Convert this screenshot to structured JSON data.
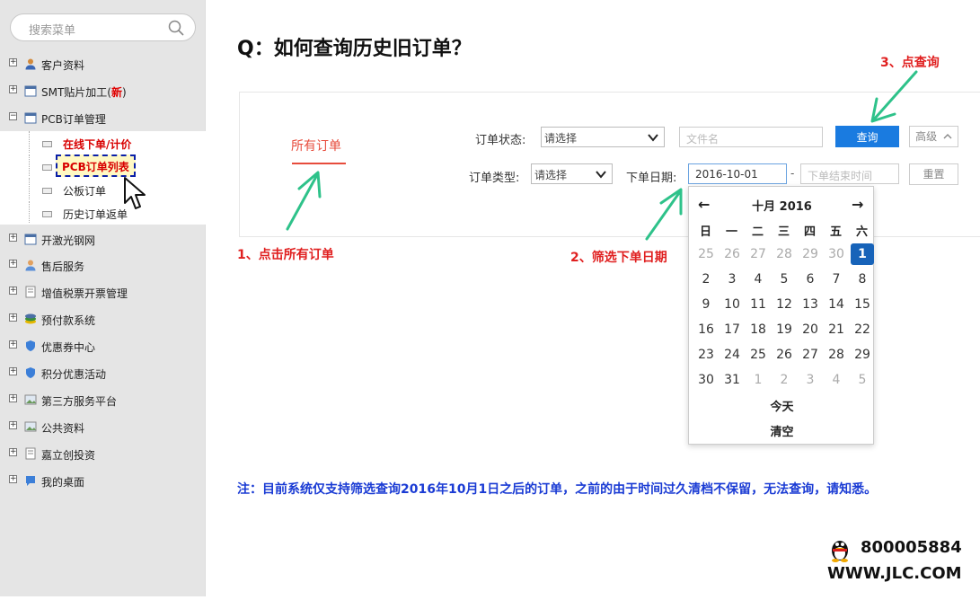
{
  "sidebar": {
    "search_placeholder": "搜索菜单",
    "items": [
      {
        "label": "客户资料"
      },
      {
        "label": "SMT贴片加工(",
        "badge": "新",
        "suffix": ")"
      },
      {
        "label": "PCB订单管理"
      },
      {
        "label": "开激光钢网"
      },
      {
        "label": "售后服务"
      },
      {
        "label": "增值税票开票管理"
      },
      {
        "label": "预付款系统"
      },
      {
        "label": "优惠券中心"
      },
      {
        "label": "积分优惠活动"
      },
      {
        "label": "第三方服务平台"
      },
      {
        "label": "公共资料"
      },
      {
        "label": "嘉立创投资"
      },
      {
        "label": "我的桌面"
      }
    ],
    "submenu": [
      "在线下单/计价",
      "PCB订单列表",
      "公板订单",
      "历史订单返单"
    ]
  },
  "heading": "Q：如何查询历史旧订单？",
  "tab_all": "所有订单",
  "filters": {
    "status_label": "订单状态:",
    "status_value": "请选择",
    "file_placeholder": "文件名",
    "query_button": "查询",
    "advanced_button": "高级",
    "type_label": "订单类型:",
    "type_value": "请选择",
    "date_label": "下单日期:",
    "date_start": "2016-10-01",
    "date_separator": "-",
    "date_end_placeholder": "下单结束时间",
    "reset_button": "重置"
  },
  "calendar": {
    "title": "十月 2016",
    "prev": "←",
    "next": "→",
    "weekdays": [
      "日",
      "一",
      "二",
      "三",
      "四",
      "五",
      "六"
    ],
    "weeks": [
      [
        "25",
        "26",
        "27",
        "28",
        "29",
        "30",
        "1"
      ],
      [
        "2",
        "3",
        "4",
        "5",
        "6",
        "7",
        "8"
      ],
      [
        "9",
        "10",
        "11",
        "12",
        "13",
        "14",
        "15"
      ],
      [
        "16",
        "17",
        "18",
        "19",
        "20",
        "21",
        "22"
      ],
      [
        "23",
        "24",
        "25",
        "26",
        "27",
        "28",
        "29"
      ],
      [
        "30",
        "31",
        "1",
        "2",
        "3",
        "4",
        "5"
      ]
    ],
    "muted": [
      [
        0,
        0
      ],
      [
        0,
        1
      ],
      [
        0,
        2
      ],
      [
        0,
        3
      ],
      [
        0,
        4
      ],
      [
        0,
        5
      ],
      [
        5,
        2
      ],
      [
        5,
        3
      ],
      [
        5,
        4
      ],
      [
        5,
        5
      ],
      [
        5,
        6
      ]
    ],
    "selected": [
      0,
      6
    ],
    "today": "今天",
    "clear": "清空"
  },
  "annotations": {
    "step1": "1、点击所有订单",
    "step2": "2、筛选下单日期",
    "step3": "3、点查询",
    "note": "注：目前系统仅支持筛选查询2016年10月1日之后的订单，之前的由于时间过久清档不保留，无法查询，请知悉。"
  },
  "contact": {
    "phone": "800005884",
    "site": "WWW.JLC.COM"
  },
  "colors": {
    "accent_blue": "#1a7be0",
    "annotation_red": "#e02020",
    "note_blue": "#1a3bd4",
    "arrow_green": "#2ec28a"
  }
}
